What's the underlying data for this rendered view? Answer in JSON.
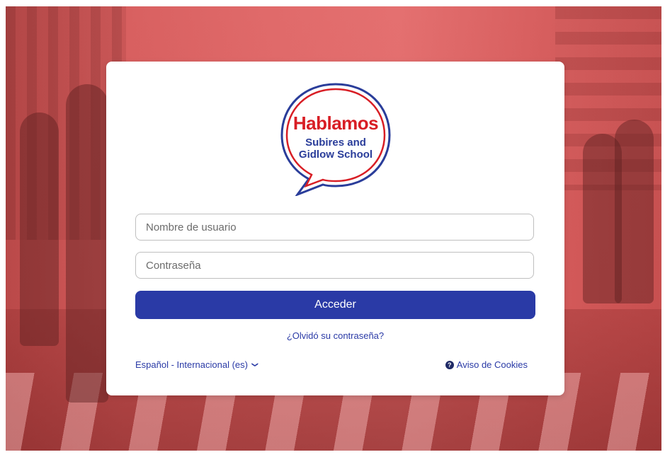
{
  "logo": {
    "title": "Hablamos",
    "line1": "Subires and",
    "line2": "Gidlow School"
  },
  "login": {
    "username_placeholder": "Nombre de usuario",
    "password_placeholder": "Contraseña",
    "submit_label": "Acceder",
    "forgot_link": "¿Olvidó su contraseña?"
  },
  "footer": {
    "language": "Español - Internacional (es)",
    "cookies": "Aviso de Cookies"
  },
  "colors": {
    "brand_red": "#d81e25",
    "brand_blue": "#2a3d9a",
    "button": "#2a3aa6"
  },
  "icons": {
    "chevron": "chevron-down-icon",
    "help": "question-circle-icon"
  }
}
